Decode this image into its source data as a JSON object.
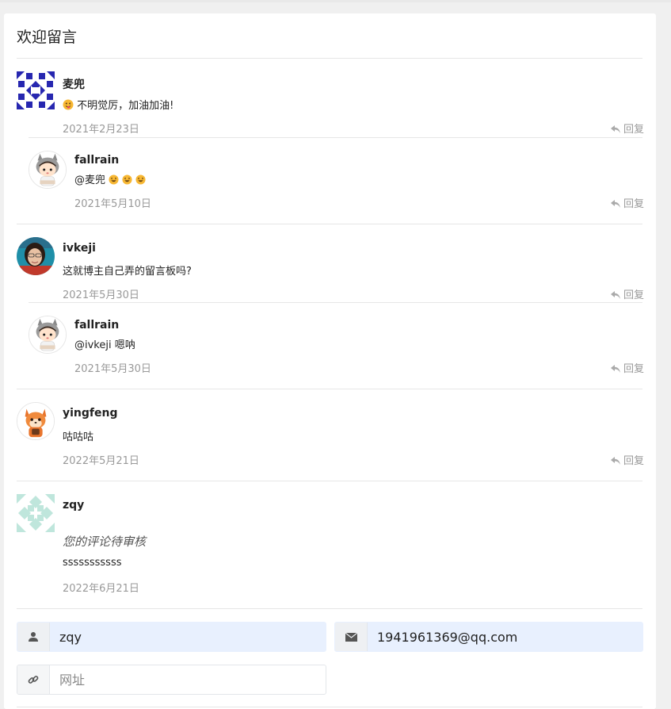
{
  "page": {
    "title": "欢迎留言"
  },
  "comments": [
    {
      "author": "麦兜",
      "text": "不明觉厉，加油加油!",
      "date": "2021年2月23日",
      "reply_label": "回复",
      "avatar": "identicon-blue"
    },
    {
      "author": "fallrain",
      "text": "@麦兜",
      "date": "2021年5月10日",
      "reply_label": "回复",
      "avatar": "cartoon-hood",
      "emoji_count": 3
    },
    {
      "author": "ivkeji",
      "text": "这就博主自己弄的留言板吗?",
      "date": "2021年5月30日",
      "reply_label": "回复",
      "avatar": "photo-woman"
    },
    {
      "author": "fallrain",
      "text": "@ivkeji 嗯呐",
      "date": "2021年5月30日",
      "reply_label": "回复",
      "avatar": "cartoon-hood"
    },
    {
      "author": "yingfeng",
      "text": "咕咕咕",
      "date": "2022年5月21日",
      "reply_label": "回复",
      "avatar": "cartoon-fox"
    },
    {
      "author": "zqy",
      "pending": "您的评论待审核",
      "text": "sssssssssss",
      "date": "2022年6月21日",
      "avatar": "identicon-mint"
    }
  ],
  "form": {
    "name_value": "zqy",
    "email_value": "1941961369@qq.com",
    "url_placeholder": "网址",
    "icons": {
      "name": "user-icon",
      "email": "envelope-icon",
      "url": "link-icon"
    }
  },
  "colors": {
    "autofill": "#e8f0fe",
    "muted": "#999999",
    "identicon_blue": "#2727b0",
    "identicon_mint": "#bfe6dc"
  }
}
